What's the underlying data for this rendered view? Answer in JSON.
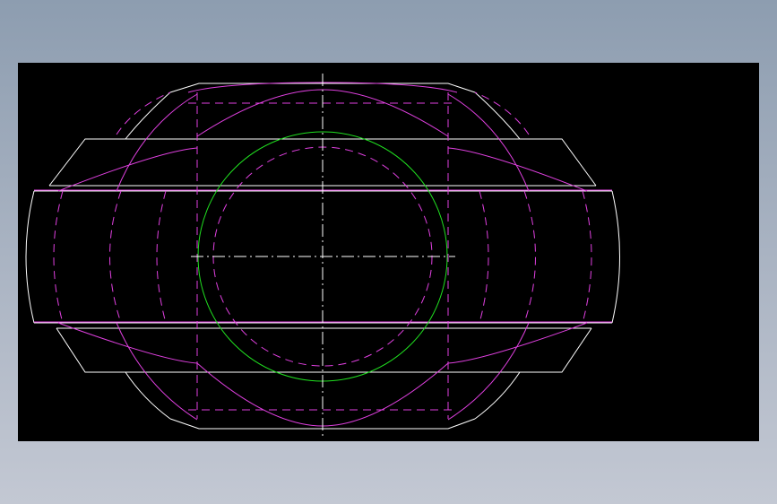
{
  "drawing": {
    "description_visible_text": "",
    "colors": {
      "background": "#000000",
      "outline": "#ffffff",
      "hidden": "#e040e0",
      "circle": "#20e020",
      "centerline": "#ffffff"
    }
  }
}
